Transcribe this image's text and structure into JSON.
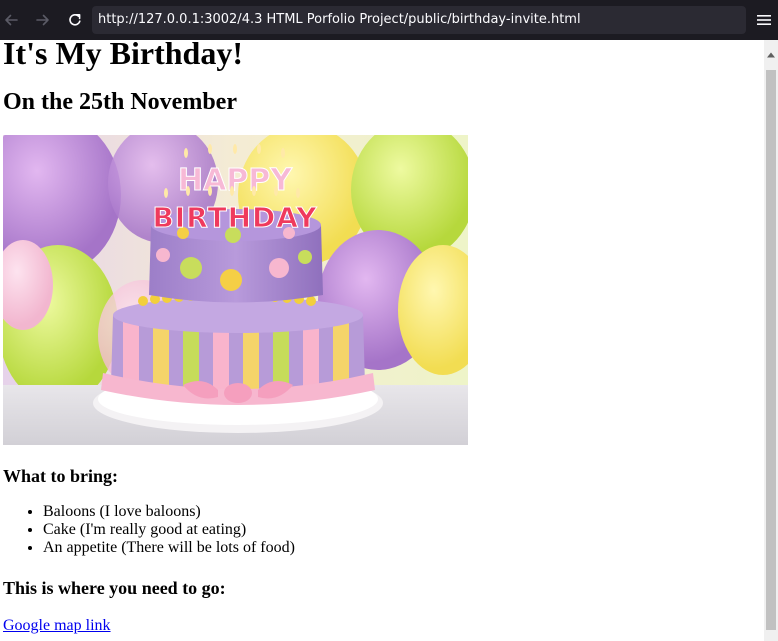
{
  "browser": {
    "url": "http://127.0.0.1:3002/4.3 HTML Porfolio Project/public/birthday-invite.html"
  },
  "page": {
    "title": "It's My Birthday!",
    "date_heading": "On the 25th November",
    "image_text": {
      "line1": "HAPPY",
      "line2": "BIRTHDAY"
    },
    "bring_heading": "What to bring:",
    "bring_items": [
      "Baloons (I love baloons)",
      "Cake (I'm really good at eating)",
      "An appetite (There will be lots of food)"
    ],
    "go_heading": "This is where you need to go:",
    "map_link": "Google map link"
  },
  "colors": {
    "toolbar_bg": "#1c1b22",
    "urlbar_bg": "#2b2a33",
    "link": "#0000ee",
    "scrollbar_thumb": "#c1c1c1"
  }
}
